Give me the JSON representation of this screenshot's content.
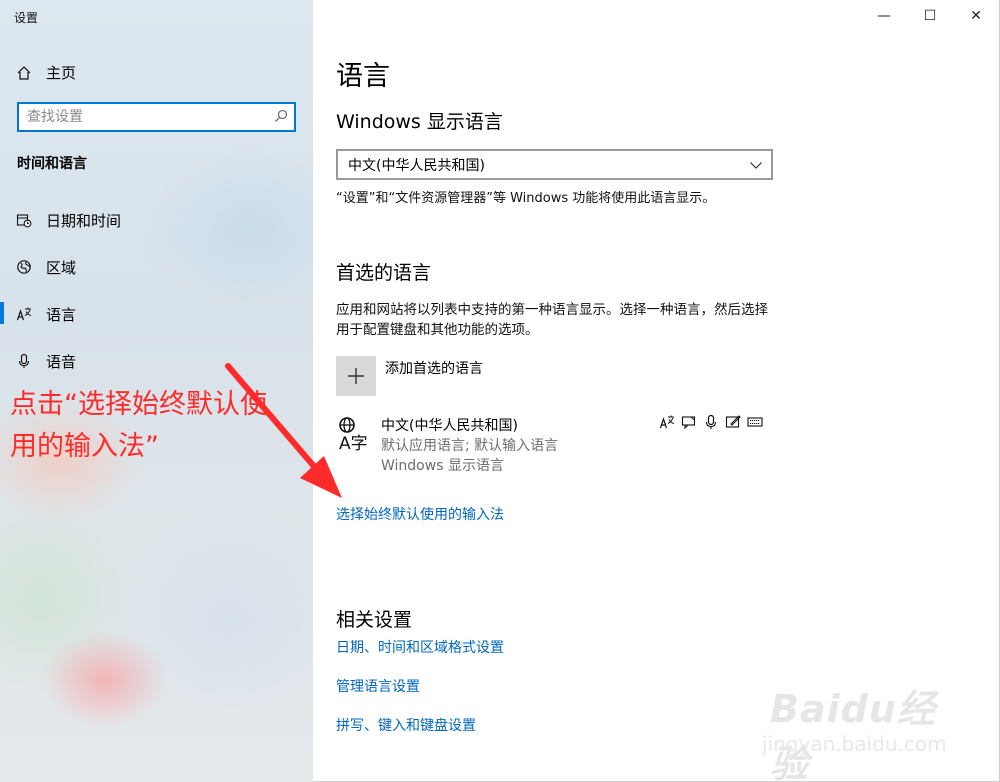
{
  "window": {
    "app_title": "设置",
    "minimize": "—",
    "maximize": "☐",
    "close": "✕"
  },
  "sidebar": {
    "home_label": "主页",
    "search_placeholder": "查找设置",
    "section_title": "时间和语言",
    "items": [
      {
        "label": "日期和时间",
        "icon": "calendar-clock-icon"
      },
      {
        "label": "区域",
        "icon": "globe-region-icon"
      },
      {
        "label": "语言",
        "icon": "language-icon",
        "active": true
      },
      {
        "label": "语音",
        "icon": "microphone-icon"
      }
    ]
  },
  "annotation": {
    "text": "点击“选择始终默认使用的输入法”",
    "color": "#ff2a2a"
  },
  "main": {
    "title": "语言",
    "display_language_heading": "Windows 显示语言",
    "display_language_value": "中文(中华人民共和国)",
    "display_language_note": "“设置”和“文件资源管理器”等 Windows 功能将使用此语言显示。",
    "preferred_heading": "首选的语言",
    "preferred_desc": "应用和网站将以列表中支持的第一种语言显示。选择一种语言，然后选择用于配置键盘和其他功能的选项。",
    "add_language_label": "添加首选的语言",
    "language_entry": {
      "name": "中文(中华人民共和国)",
      "detail1": "默认应用语言; 默认输入语言",
      "detail2": "Windows 显示语言",
      "icon_text": "A字"
    },
    "choose_input_link": "选择始终默认使用的输入法",
    "related_heading": "相关设置",
    "related_links": [
      "日期、时间和区域格式设置",
      "管理语言设置",
      "拼写、键入和键盘设置"
    ]
  },
  "watermark": {
    "brand": "Baidu经验",
    "site": "jingyan.baidu.com"
  },
  "colors": {
    "accent": "#0078d7",
    "link": "#0067c0"
  }
}
